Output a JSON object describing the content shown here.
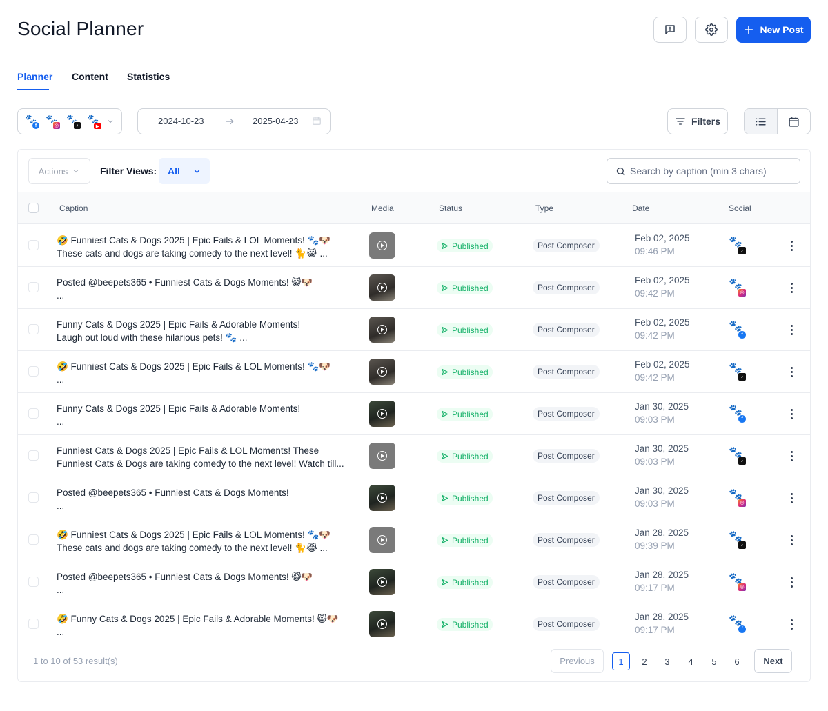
{
  "header": {
    "title": "Social Planner",
    "new_post_label": "New Post"
  },
  "tabs": [
    {
      "label": "Planner",
      "active": true
    },
    {
      "label": "Content",
      "active": false
    },
    {
      "label": "Statistics",
      "active": false
    }
  ],
  "toolbar": {
    "accounts": [
      "facebook",
      "instagram",
      "tiktok",
      "youtube"
    ],
    "date_start": "2024-10-23",
    "date_end": "2025-04-23",
    "filters_label": "Filters",
    "view_mode": "list"
  },
  "table_controls": {
    "actions_label": "Actions",
    "filter_views_label": "Filter Views:",
    "filter_views_value": "All",
    "search_placeholder": "Search by caption (min 3 chars)"
  },
  "columns": {
    "caption": "Caption",
    "media": "Media",
    "status": "Status",
    "type": "Type",
    "date": "Date",
    "social": "Social"
  },
  "rows": [
    {
      "line1": "🤣 Funniest Cats & Dogs 2025 | Epic Fails & LOL Moments! 🐾🐶",
      "line2": "These cats and dogs are taking comedy to the next level! 🐈😹 ...",
      "media": "gray",
      "status": "Published",
      "type": "Post Composer",
      "date": "Feb 02, 2025",
      "time": "09:46 PM",
      "social": "tiktok"
    },
    {
      "line1": "Posted @beepets365 • Funniest Cats & Dogs Moments! 😸🐶",
      "line2": "...",
      "media": "photo",
      "status": "Published",
      "type": "Post Composer",
      "date": "Feb 02, 2025",
      "time": "09:42 PM",
      "social": "instagram"
    },
    {
      "line1": "Funny Cats & Dogs 2025 | Epic Fails & Adorable Moments!",
      "line2": "Laugh out loud with these hilarious pets! 🐾 ...",
      "media": "photo",
      "status": "Published",
      "type": "Post Composer",
      "date": "Feb 02, 2025",
      "time": "09:42 PM",
      "social": "facebook"
    },
    {
      "line1": "🤣 Funniest Cats & Dogs 2025 | Epic Fails & LOL Moments! 🐾🐶",
      "line2": "...",
      "media": "photo",
      "status": "Published",
      "type": "Post Composer",
      "date": "Feb 02, 2025",
      "time": "09:42 PM",
      "social": "tiktok"
    },
    {
      "line1": "Funny Cats & Dogs 2025 | Epic Fails & Adorable Moments!",
      "line2": "...",
      "media": "photo2",
      "status": "Published",
      "type": "Post Composer",
      "date": "Jan 30, 2025",
      "time": "09:03 PM",
      "social": "facebook"
    },
    {
      "line1": "Funniest Cats & Dogs 2025 | Epic Fails & LOL Moments! These",
      "line2": "Funniest Cats & Dogs are taking comedy to the next level! Watch till...",
      "media": "gray",
      "status": "Published",
      "type": "Post Composer",
      "date": "Jan 30, 2025",
      "time": "09:03 PM",
      "social": "tiktok"
    },
    {
      "line1": "Posted @beepets365 • Funniest Cats & Dogs Moments!",
      "line2": "...",
      "media": "photo2",
      "status": "Published",
      "type": "Post Composer",
      "date": "Jan 30, 2025",
      "time": "09:03 PM",
      "social": "instagram"
    },
    {
      "line1": "🤣 Funniest Cats & Dogs 2025 | Epic Fails & LOL Moments! 🐾🐶",
      "line2": "These cats and dogs are taking comedy to the next level! 🐈😹 ...",
      "media": "gray",
      "status": "Published",
      "type": "Post Composer",
      "date": "Jan 28, 2025",
      "time": "09:39 PM",
      "social": "tiktok"
    },
    {
      "line1": "Posted @beepets365 • Funniest Cats & Dogs Moments! 😸🐶",
      "line2": "...",
      "media": "photo2",
      "status": "Published",
      "type": "Post Composer",
      "date": "Jan 28, 2025",
      "time": "09:17 PM",
      "social": "instagram"
    },
    {
      "line1": "🤣 Funny Cats & Dogs 2025 | Epic Fails & Adorable Moments! 😸🐶",
      "line2": "...",
      "media": "photo2",
      "status": "Published",
      "type": "Post Composer",
      "date": "Jan 28, 2025",
      "time": "09:17 PM",
      "social": "facebook"
    }
  ],
  "pagination": {
    "summary": "1 to 10 of 53 result(s)",
    "previous_label": "Previous",
    "next_label": "Next",
    "pages": [
      "1",
      "2",
      "3",
      "4",
      "5",
      "6"
    ],
    "current_page": "1"
  },
  "colors": {
    "primary": "#155eef",
    "published": "#17b26a",
    "published_bg": "#ecfdf3"
  }
}
